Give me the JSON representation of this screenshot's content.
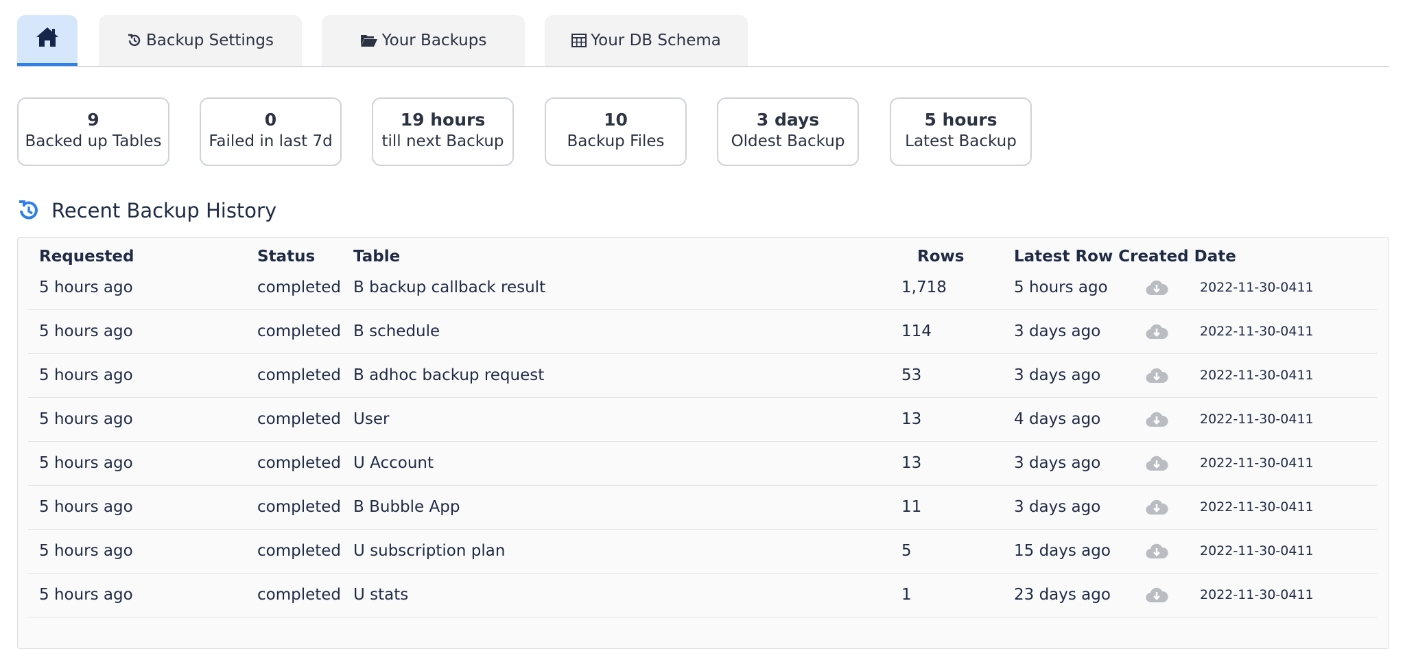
{
  "tabs": [
    {
      "name": "home",
      "label": ""
    },
    {
      "name": "backup-settings",
      "label": "Backup Settings"
    },
    {
      "name": "your-backups",
      "label": "Your Backups"
    },
    {
      "name": "db-schema",
      "label": "Your DB Schema"
    }
  ],
  "stats": [
    {
      "value": "9",
      "label": "Backed up Tables"
    },
    {
      "value": "0",
      "label": "Failed in last 7d"
    },
    {
      "value": "19 hours",
      "label": "till next Backup"
    },
    {
      "value": "10",
      "label": "Backup Files"
    },
    {
      "value": "3 days",
      "label": "Oldest Backup"
    },
    {
      "value": "5 hours",
      "label": "Latest Backup"
    }
  ],
  "history": {
    "title": "Recent Backup History",
    "columns": {
      "requested": "Requested",
      "status": "Status",
      "table": "Table",
      "rows": "Rows",
      "latest": "Latest Row Created Date"
    },
    "rows": [
      {
        "requested": "5 hours ago",
        "status": "completed",
        "table": "B backup callback result",
        "rows": "1,718",
        "latest": "5 hours ago",
        "file": "2022-11-30-0411"
      },
      {
        "requested": "5 hours ago",
        "status": "completed",
        "table": "B schedule",
        "rows": "114",
        "latest": "3 days ago",
        "file": "2022-11-30-0411"
      },
      {
        "requested": "5 hours ago",
        "status": "completed",
        "table": "B adhoc backup request",
        "rows": "53",
        "latest": "3 days ago",
        "file": "2022-11-30-0411"
      },
      {
        "requested": "5 hours ago",
        "status": "completed",
        "table": "User",
        "rows": "13",
        "latest": "4 days ago",
        "file": "2022-11-30-0411"
      },
      {
        "requested": "5 hours ago",
        "status": "completed",
        "table": "U Account",
        "rows": "13",
        "latest": "3 days ago",
        "file": "2022-11-30-0411"
      },
      {
        "requested": "5 hours ago",
        "status": "completed",
        "table": "B Bubble App",
        "rows": "11",
        "latest": "3 days ago",
        "file": "2022-11-30-0411"
      },
      {
        "requested": "5 hours ago",
        "status": "completed",
        "table": "U subscription plan",
        "rows": "5",
        "latest": "15 days ago",
        "file": "2022-11-30-0411"
      },
      {
        "requested": "5 hours ago",
        "status": "completed",
        "table": "U stats",
        "rows": "1",
        "latest": "23 days ago",
        "file": "2022-11-30-0411"
      }
    ]
  },
  "colors": {
    "accent": "#2f7fe5",
    "home_tab_bg": "#d6e6fb",
    "tab_bg": "#f3f3f4",
    "text": "#1f2a44"
  },
  "icons": {
    "home": "home-icon",
    "settings": "history-icon",
    "backups": "folder-open-icon",
    "schema": "table-grid-icon",
    "section": "history-icon",
    "download": "cloud-download-icon"
  }
}
